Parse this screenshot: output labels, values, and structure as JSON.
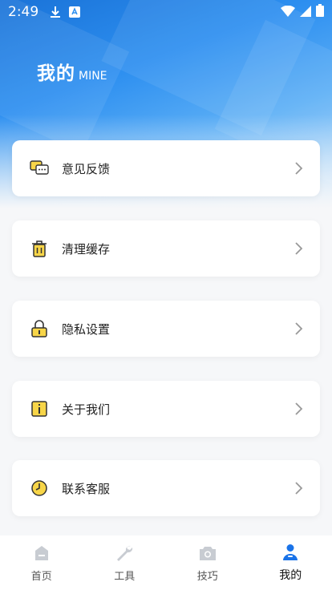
{
  "status_bar": {
    "time": "2:49",
    "icons": [
      "download-icon",
      "app-notification-icon",
      "wifi-icon",
      "signal-icon",
      "battery-icon"
    ]
  },
  "header": {
    "title": "我的",
    "subtitle": "MINE"
  },
  "menu": {
    "items": [
      {
        "label": "意见反馈",
        "icon": "feedback-icon"
      },
      {
        "label": "清理缓存",
        "icon": "trash-icon"
      },
      {
        "label": "隐私设置",
        "icon": "lock-icon"
      },
      {
        "label": "关于我们",
        "icon": "info-icon"
      },
      {
        "label": "联系客服",
        "icon": "clock-icon"
      }
    ]
  },
  "tabbar": {
    "tabs": [
      {
        "label": "首页",
        "icon": "home-icon"
      },
      {
        "label": "工具",
        "icon": "wrench-icon"
      },
      {
        "label": "技巧",
        "icon": "camera-icon"
      },
      {
        "label": "我的",
        "icon": "user-icon",
        "active": true
      }
    ]
  },
  "colors": {
    "accent": "#1a73e8",
    "icon_yellow": "#f7d548",
    "inactive_icon": "#c8ccd2"
  }
}
